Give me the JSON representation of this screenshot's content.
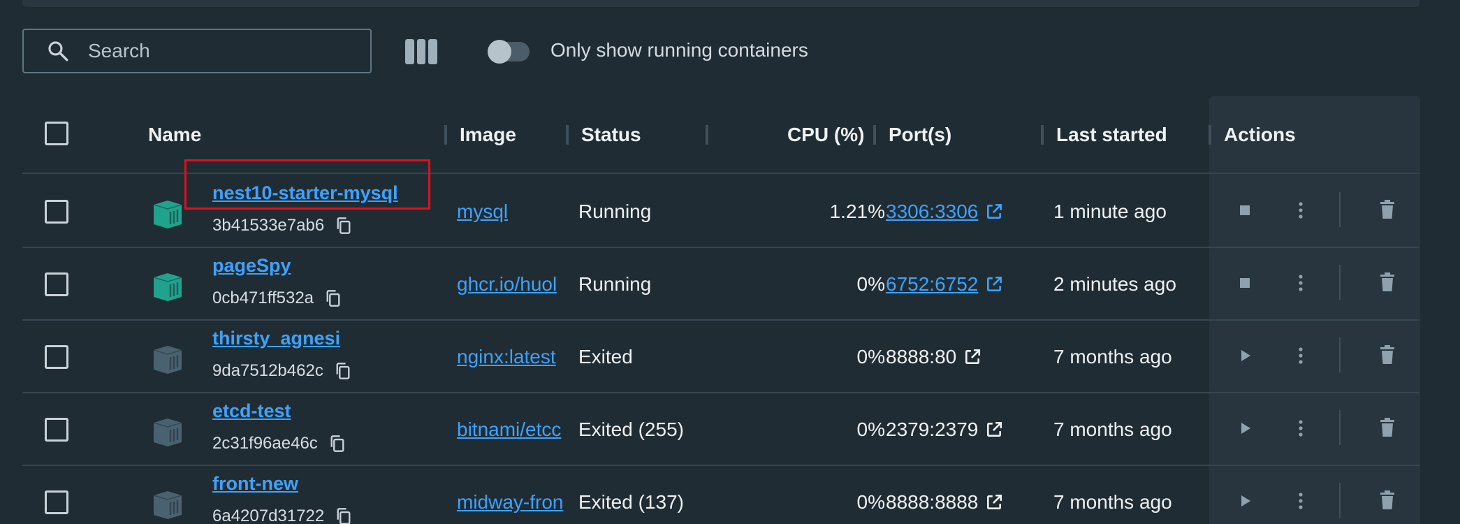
{
  "toolbar": {
    "search_placeholder": "Search",
    "toggle_label": "Only show running containers",
    "toggle_on": false
  },
  "table": {
    "headers": {
      "name": "Name",
      "image": "Image",
      "status": "Status",
      "cpu": "CPU (%)",
      "ports": "Port(s)",
      "last_started": "Last started",
      "actions": "Actions"
    },
    "rows": [
      {
        "name": "nest10-starter-mysql",
        "id": "3b41533e7ab6",
        "image": "mysql",
        "status": "Running",
        "cpu": "1.21%",
        "port": "3306:3306",
        "port_link": true,
        "last_started": "1 minute ago",
        "running": true
      },
      {
        "name": "pageSpy",
        "id": "0cb471ff532a",
        "image": "ghcr.io/huol",
        "status": "Running",
        "cpu": "0%",
        "port": "6752:6752",
        "port_link": true,
        "last_started": "2 minutes ago",
        "running": true
      },
      {
        "name": "thirsty_agnesi",
        "id": "9da7512b462c",
        "image": "nginx:latest",
        "status": "Exited",
        "cpu": "0%",
        "port": "8888:80",
        "port_link": false,
        "last_started": "7 months ago",
        "running": false
      },
      {
        "name": "etcd-test",
        "id": "2c31f96ae46c",
        "image": "bitnami/etcc",
        "status": "Exited (255)",
        "cpu": "0%",
        "port": "2379:2379",
        "port_link": false,
        "last_started": "7 months ago",
        "running": false
      },
      {
        "name": "front-new",
        "id": "6a4207d31722",
        "image": "midway-fron",
        "status": "Exited (137)",
        "cpu": "0%",
        "port": "8888:8888",
        "port_link": false,
        "last_started": "7 months ago",
        "running": false
      }
    ]
  },
  "colors": {
    "link": "#3ea2ff",
    "running_icon": "#1fa38c",
    "exited_icon": "#4a6270",
    "highlight": "#e0101a"
  }
}
